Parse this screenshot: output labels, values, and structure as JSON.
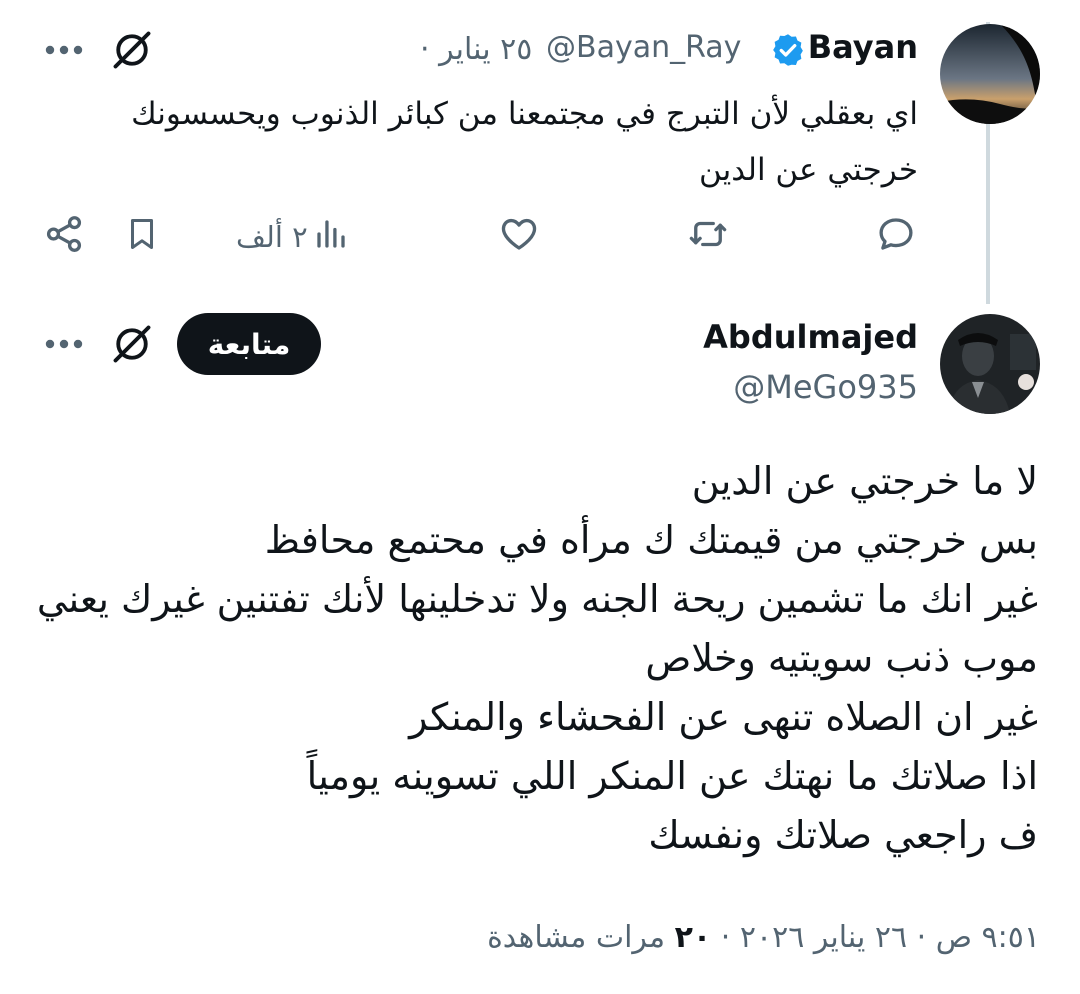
{
  "reply_tweet": {
    "name": "Bayan",
    "handle": "@Bayan_Ray",
    "date": "٢٥ يناير",
    "separator": "·",
    "text_lines": [
      "اي بعقلي لأن التبرج في مجتمعنا من كبائر الذنوب ويحسسونك",
      "خرجتي عن الدين"
    ],
    "views": "٢ ألف",
    "icons": {
      "verified": "verified-badge-icon",
      "grok": "grok-icon",
      "more": "more-icon",
      "reply": "reply-icon",
      "retweet": "retweet-icon",
      "like": "like-icon",
      "views": "views-icon",
      "bookmark": "bookmark-icon",
      "share": "share-icon"
    }
  },
  "main_tweet": {
    "name": "Abdulmajed",
    "handle": "@MeGo935",
    "follow_label": "متابعة",
    "text_lines": [
      "لا ما خرجتي عن الدين",
      "بس خرجتي من قيمتك ك مرأه في محتمع محافظ",
      "غير انك ما تشمين ريحة الجنه ولا تدخلينها لأنك تفتنين غيرك يعني",
      "موب ذنب سويتيه وخلاص",
      "غير ان الصلاه تنهى عن الفحشاء والمنكر",
      "اذا صلاتك ما نهتك عن المنكر اللي تسوينه يومياً",
      "ف راجعي صلاتك ونفسك"
    ],
    "footer": {
      "time": "٩:٥١ ص",
      "date": "٢٦ يناير ٢٠٢٦",
      "separator": "·",
      "views_count": "٢٠",
      "views_label": "مرات مشاهدة"
    }
  },
  "colors": {
    "text": "#0f1419",
    "secondary": "#536471",
    "verified": "#1d9bf0",
    "thread_line": "#cfd9de",
    "follow_bg": "#0f1419"
  }
}
